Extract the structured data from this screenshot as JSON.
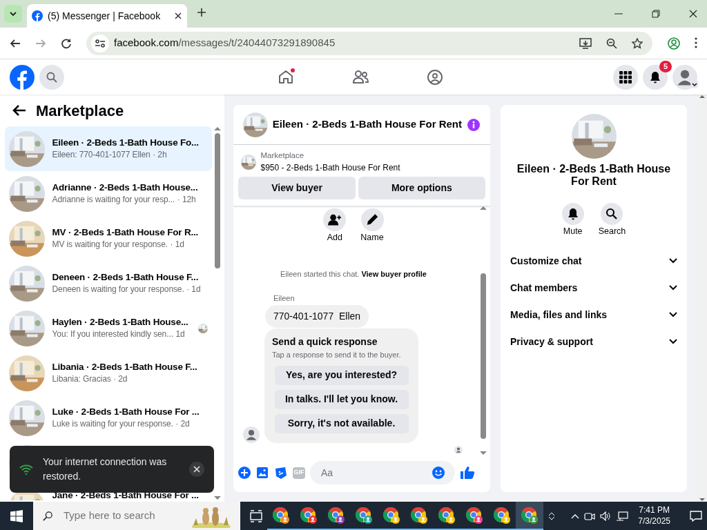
{
  "browser": {
    "tab_title": "(5) Messenger | Facebook",
    "url_domain": "facebook.com",
    "url_path": "/messages/t/24044073291890845"
  },
  "header": {
    "nav": [
      {
        "kind": "home",
        "dot": true
      },
      {
        "kind": "friends",
        "dot": false
      },
      {
        "kind": "groups",
        "dot": false
      }
    ],
    "notification_count": "5"
  },
  "sidebar": {
    "title": "Marketplace",
    "conversations": [
      {
        "kind": "row",
        "title": "Eileen · 2-Beds 1-Bath House Fo...",
        "preview": "Eileen: 770-401-1077 Ellen",
        "time": "· 2h",
        "selected": true,
        "seen": false
      },
      {
        "kind": "row",
        "title": "Adrianne · 2-Beds 1-Bath House...",
        "preview": "Adrianne is waiting for your resp...",
        "time": "· 12h",
        "selected": false,
        "seen": false
      },
      {
        "kind": "row",
        "title": "MV · 2-Beds 1-Bath House For R...",
        "preview": "MV is waiting for your response.",
        "time": "· 1d",
        "selected": false,
        "seen": false
      },
      {
        "kind": "row",
        "title": "Deneen · 2-Beds 1-Bath House F...",
        "preview": "Deneen is waiting for your response.",
        "time": "· 1d",
        "selected": false,
        "seen": false
      },
      {
        "kind": "row",
        "title": "Haylen · 2-Beds 1-Bath House...",
        "preview": "You: If you interested kindly sen...",
        "time": "1d",
        "selected": false,
        "seen": true
      },
      {
        "kind": "row",
        "title": "Libania · 2-Beds 1-Bath House F...",
        "preview": "Libania: Gracias",
        "time": "· 2d",
        "selected": false,
        "seen": false
      },
      {
        "kind": "row",
        "title": "Luke · 2-Beds 1-Bath House For ...",
        "preview": "Luke is waiting for your response.",
        "time": "· 2d",
        "selected": false,
        "seen": false
      },
      {
        "kind": "covered"
      },
      {
        "kind": "title_only",
        "title": "Jane · 2-Beds 1-Bath House For ..."
      }
    ]
  },
  "toast": {
    "text": "Your internet connection was restored."
  },
  "chat": {
    "title": "Eileen · 2-Beds 1-Bath House For Rent",
    "listing_label": "Marketplace",
    "listing": "$950 - 2-Beds 1-Bath House For Rent",
    "buttons": [
      "View buyer",
      "More options"
    ],
    "actions": [
      {
        "kind": "add",
        "label": "Add"
      },
      {
        "kind": "name",
        "label": "Name"
      }
    ],
    "system_text": "Eileen started this chat.",
    "system_link": "View buyer profile",
    "sender": "Eileen",
    "message": "770-401-1077  Ellen",
    "quick": {
      "title": "Send a quick response",
      "subtitle": "Tap a response to send it to the buyer.",
      "options": [
        "Yes, are you interested?",
        "In talks. I'll let you know.",
        "Sorry, it's not available."
      ]
    },
    "gif": "GIF",
    "placeholder": "Aa"
  },
  "details": {
    "title": "Eileen · 2-Beds 1-Bath House For Rent",
    "actions": [
      {
        "kind": "mute",
        "label": "Mute"
      },
      {
        "kind": "search",
        "label": "Search"
      }
    ],
    "sections": [
      {
        "label": "Customize chat",
        "expanded": false
      },
      {
        "label": "Chat members",
        "expanded": false
      },
      {
        "label": "Media, files and links",
        "expanded": false
      },
      {
        "label": "Privacy & support",
        "expanded": false
      }
    ]
  },
  "taskbar": {
    "search_placeholder": "Type here to search",
    "time": "7:41 PM",
    "date": "7/3/2025",
    "apps": [
      {
        "color": "#f28b30",
        "selected": false
      },
      {
        "color": "#e53935",
        "selected": false
      },
      {
        "color": "#8e44ad",
        "selected": false
      },
      {
        "color": "#26a69a",
        "selected": false
      },
      {
        "color": "#f5c518",
        "selected": false
      },
      {
        "color": "#f5c518",
        "selected": false
      },
      {
        "color": "#f5c518",
        "selected": false
      },
      {
        "color": "#e84393",
        "selected": false
      },
      {
        "color": "#f5c518",
        "selected": false
      },
      {
        "color": "#43a047",
        "selected": true
      }
    ]
  }
}
